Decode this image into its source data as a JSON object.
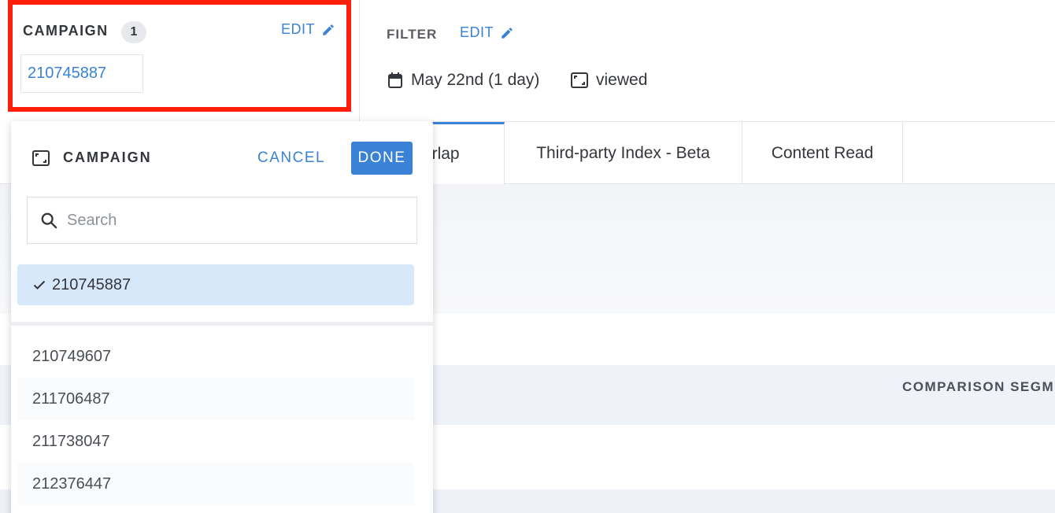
{
  "campaign_panel": {
    "title": "CAMPAIGN",
    "count": "1",
    "edit_label": "EDIT",
    "selected_value": "210745887",
    "pencil_icon": "pencil-icon"
  },
  "filter_panel": {
    "title": "FILTER",
    "edit_label": "EDIT",
    "date_label": "May 22nd (1 day)",
    "date_icon": "calendar-icon",
    "viewed_label": "viewed",
    "viewed_icon": "frame-icon"
  },
  "tabs": [
    {
      "label": "verlap",
      "active": true
    },
    {
      "label": "Third-party Index - Beta",
      "active": false
    },
    {
      "label": "Content Read",
      "active": false
    }
  ],
  "background": {
    "comparison_label": "COMPARISON SEGM"
  },
  "dropdown": {
    "title": "CAMPAIGN",
    "title_icon": "frame-icon",
    "cancel_label": "CANCEL",
    "done_label": "DONE",
    "search_placeholder": "Search",
    "search_value": "",
    "selected_item": "210745887",
    "items": [
      "210749607",
      "211706487",
      "211738047",
      "212376447"
    ]
  },
  "colors": {
    "accent": "#3a82d6",
    "highlight": "#ff1e0a",
    "selected_bg": "#d7e8fb"
  }
}
